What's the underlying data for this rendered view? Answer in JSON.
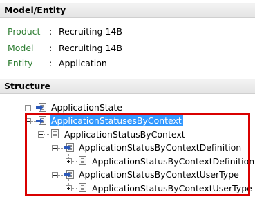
{
  "model_section": {
    "title": "Model/Entity",
    "rows": [
      {
        "label": "Product",
        "separator": ":",
        "value": "Recruiting 14B"
      },
      {
        "label": "Model",
        "separator": ":",
        "value": "Recruiting 14B"
      },
      {
        "label": "Entity",
        "separator": ":",
        "value": "Application"
      }
    ]
  },
  "structure_section": {
    "title": "Structure",
    "nodes": [
      {
        "label": "ApplicationState",
        "expanded": false
      },
      {
        "label": "ApplicationStatusesByContext",
        "expanded": true,
        "selected": true
      },
      {
        "label": "ApplicationStatusByContext",
        "expanded": true
      },
      {
        "label": "ApplicationStatusByContextDefinition",
        "expanded": true
      },
      {
        "label": "ApplicationStatusByContextDefinition",
        "expanded": false
      },
      {
        "label": "ApplicationStatusByContextUserType",
        "expanded": true
      },
      {
        "label": "ApplicationStatusByContextUserType",
        "expanded": false
      }
    ]
  },
  "colors": {
    "property_label": "#2e7d32",
    "selection": "#3399ff",
    "highlight_border": "#d90000"
  }
}
